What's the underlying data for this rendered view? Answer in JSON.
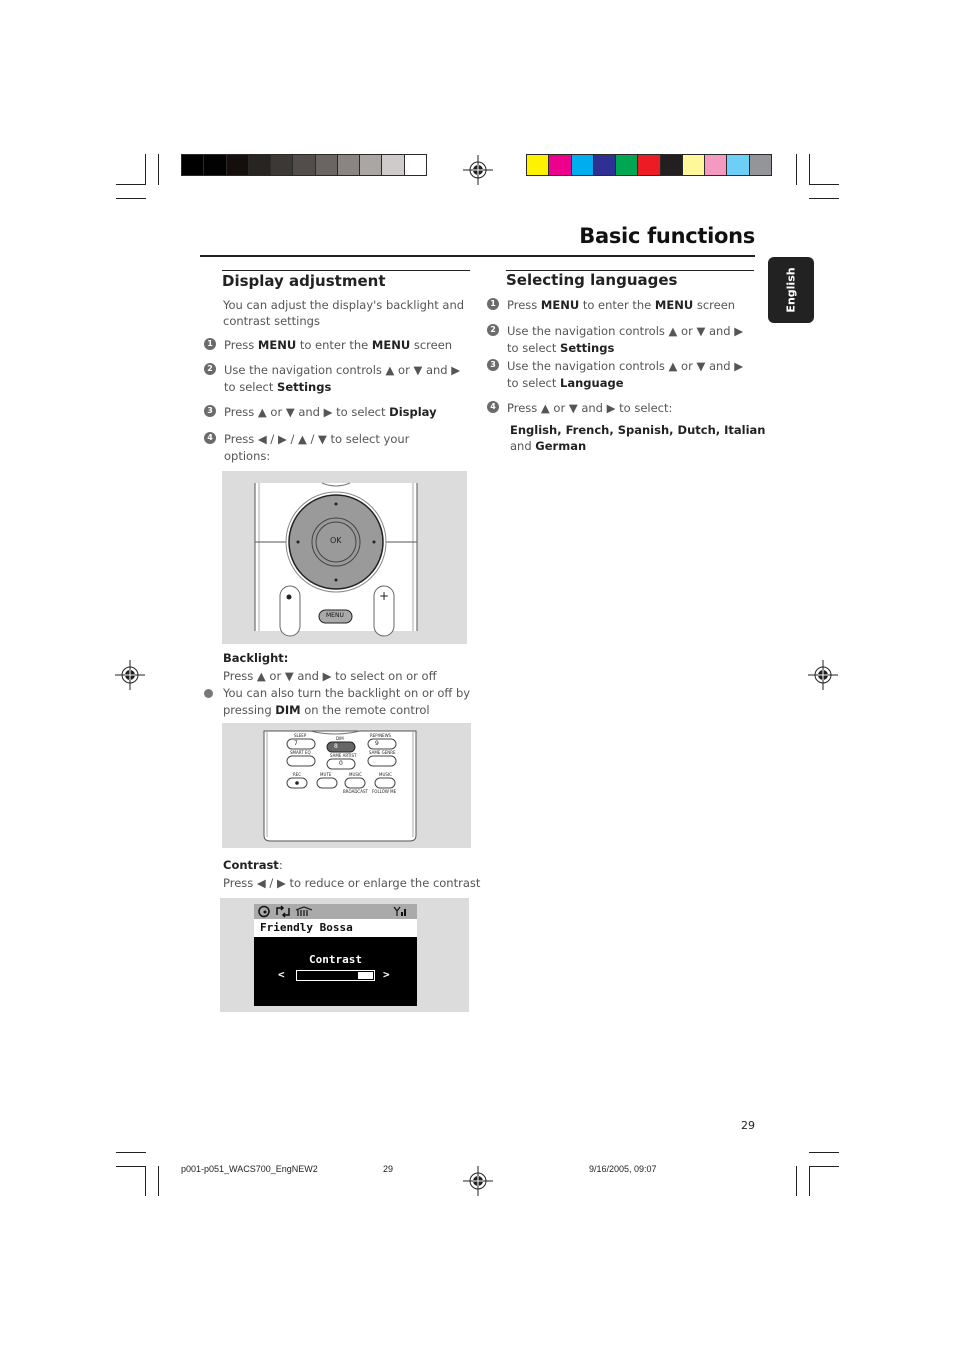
{
  "header": {
    "title": "Basic functions",
    "language_tab": "English"
  },
  "color_bars": {
    "grayscale": [
      "#000000",
      "#020202",
      "#140e0c",
      "#282422",
      "#3c3836",
      "#524c4a",
      "#6a6462",
      "#8a8482",
      "#aaa6a4",
      "#cfcbcb",
      "#ffffff"
    ],
    "process": [
      "#fff200",
      "#ec008c",
      "#00aeef",
      "#2e3192",
      "#00a651",
      "#ed1c24",
      "#231f20",
      "#fff799",
      "#f49ac1",
      "#6dcff6",
      "#939598"
    ]
  },
  "display_adjustment": {
    "title": "Display adjustment",
    "intro_line1": "You can adjust the display's  backlight and",
    "intro_line2": "contrast settings",
    "steps": [
      {
        "num": "1",
        "line1_pre": "Press ",
        "line1_b1": "MENU",
        "line1_mid": " to enter the ",
        "line1_b2": "MENU",
        "line1_post": " screen"
      },
      {
        "num": "2",
        "line1": "Use the navigation controls  ▲  or  ▼  and ▶",
        "line2_pre": " to select ",
        "line2_b": "Settings"
      },
      {
        "num": "3",
        "line1_pre": "Press  ▲  or ▼  and ▶ to  select ",
        "line1_b": "Display"
      },
      {
        "num": "4",
        "line1": "Press  ◀  /  ▶  /  ▲  /  ▼  to  select  your",
        "line2": " options:"
      }
    ],
    "remote_image": {
      "ok_label": "OK",
      "menu_label": "MENU",
      "plus_label": "+"
    },
    "backlight": {
      "label": "Backlight:",
      "instruction": "Press ▲  or  ▼  and ▶ to select on or off",
      "note_line1": "You can also turn the backlight on or off by",
      "note_line2_pre": "pressing ",
      "note_line2_b": "DIM",
      "note_line2_post": " on the remote control"
    },
    "remote_buttons": {
      "sleep": "SLEEP",
      "dim": "DIM",
      "repeat_news": "REP/NEWS",
      "smart_eq": "SMART EQ",
      "same_artist": "SAME ARTIST",
      "same_genre": "SAME GENRE",
      "rec": "REC",
      "mute": "MUTE",
      "music_broadcast": "MUSIC",
      "music_follow": "MUSIC",
      "broadcast": "BROADCAST",
      "follow_me": "FOLLOW ME",
      "key7": "7",
      "key8": "8",
      "key9": "9",
      "key0": "0"
    },
    "contrast": {
      "label": "Contrast",
      "label_suffix": ":",
      "instruction": "Press  ◀  /  ▶  to reduce or enlarge the contrast",
      "screen": {
        "track_name": "Friendly Bossa",
        "menu_title": "Contrast",
        "left_arrow": "<",
        "right_arrow": ">",
        "level_fraction": 0.2
      }
    }
  },
  "selecting_languages": {
    "title": "Selecting languages",
    "steps": [
      {
        "num": "1",
        "line1_pre": "Press ",
        "line1_b1": "MENU",
        "line1_mid": " to enter the ",
        "line1_b2": "MENU",
        "line1_post": " screen"
      },
      {
        "num": "2",
        "line1": "Use the navigation controls  ▲  or  ▼  and ▶",
        "line2_pre": " to select ",
        "line2_b": "Settings"
      },
      {
        "num": "3",
        "line1": "Use the navigation controls  ▲  or  ▼  and ▶",
        "line2_pre": " to select ",
        "line2_b": "Language"
      },
      {
        "num": "4",
        "line1": "Press  ▲  or ▼  and ▶ to  select:"
      }
    ],
    "languages_line1": "English, French, Spanish, Dutch, Italian",
    "languages_line2_pre": "and ",
    "languages_line2_b": "German"
  },
  "page_number": "29",
  "footer": {
    "filename": "p001-p051_WACS700_EngNEW2",
    "page": "29",
    "datetime": "9/16/2005, 09:07"
  }
}
